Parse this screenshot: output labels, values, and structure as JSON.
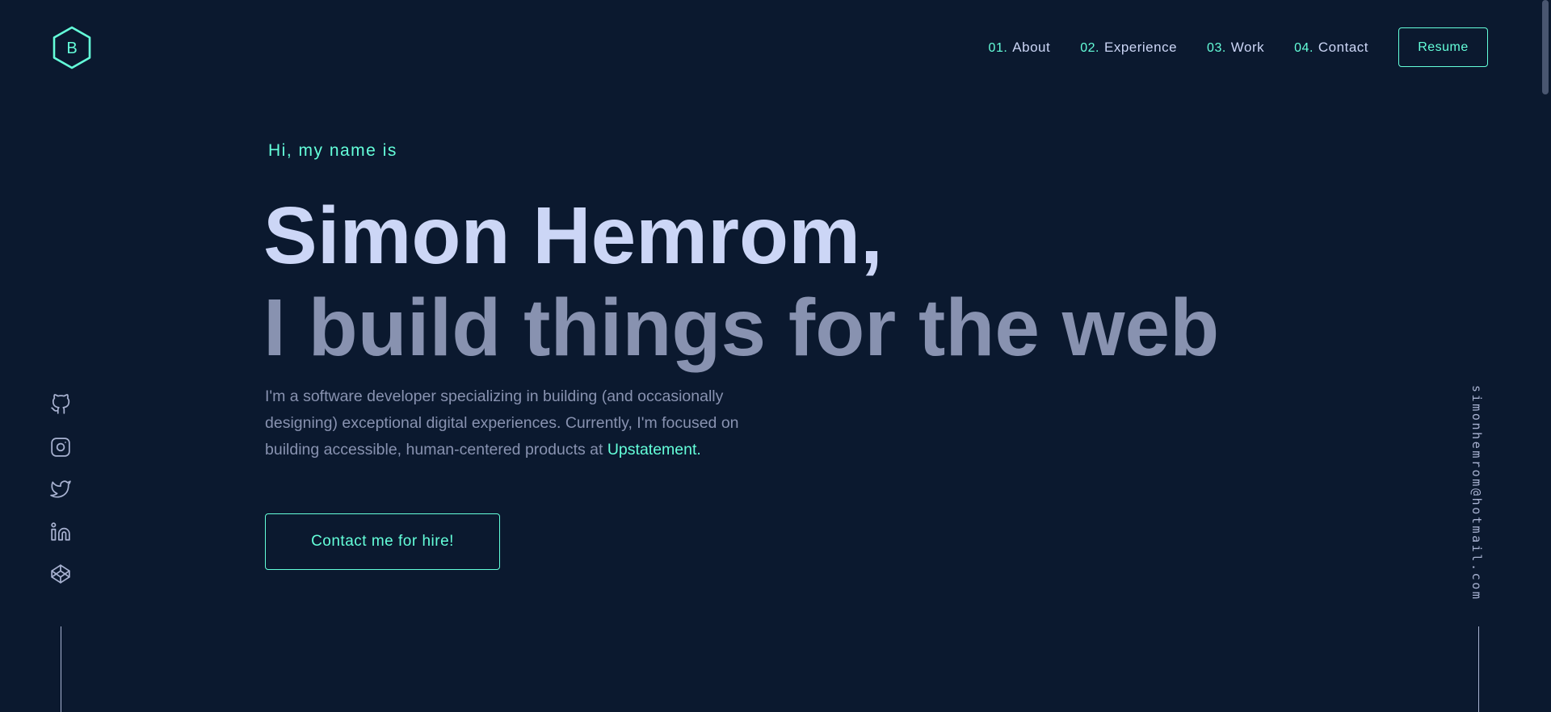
{
  "colors": {
    "background": "#0b192f",
    "accent": "#64ffda",
    "heading": "#ccd6f6",
    "text": "#8892b0",
    "rail": "#a8b2d1"
  },
  "header": {
    "logo": {
      "letter": "B",
      "icon": "hexagon-logo-icon"
    },
    "nav": [
      {
        "number": "01.",
        "label": "About"
      },
      {
        "number": "02.",
        "label": "Experience"
      },
      {
        "number": "03.",
        "label": "Work"
      },
      {
        "number": "04.",
        "label": "Contact"
      }
    ],
    "resume_label": "Resume"
  },
  "hero": {
    "greeting": "Hi, my name is",
    "name": "Simon Hemrom,",
    "tagline": "I build things for the web",
    "description": "I'm a software developer specializing in building (and occasionally designing) exceptional digital experiences. Currently, I'm focused on building accessible, human-centered products at ",
    "company_link": "Upstatement.",
    "cta_label": "Contact me for hire!"
  },
  "social": [
    {
      "icon": "github-icon"
    },
    {
      "icon": "instagram-icon"
    },
    {
      "icon": "twitter-icon"
    },
    {
      "icon": "linkedin-icon"
    },
    {
      "icon": "codepen-icon"
    }
  ],
  "email": "simonhemrom@hotmail.com"
}
